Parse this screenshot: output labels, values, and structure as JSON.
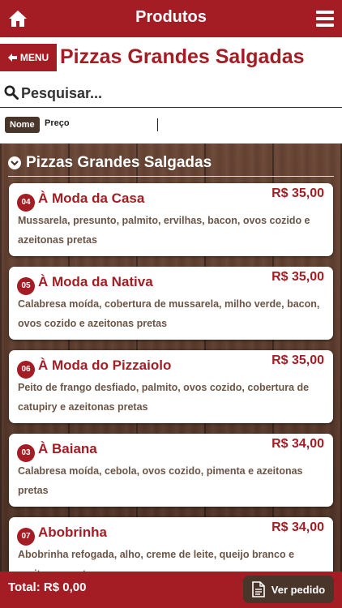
{
  "header": {
    "title": "Produtos",
    "icons": [
      "home-icon",
      "hamburger-menu-icon"
    ]
  },
  "menu_button": {
    "label": "MENU",
    "icon": "arrow-left-icon"
  },
  "page_title": "Pizzas Grandes Salgadas",
  "search": {
    "placeholder": "Pesquisar...",
    "value": "",
    "icon": "search-icon"
  },
  "sort": {
    "nome_label": "Nome",
    "preco_label": "Preço",
    "active": "Nome"
  },
  "section": {
    "title": "Pizzas Grandes Salgadas",
    "icon": "chevron-down-circle-icon"
  },
  "items": [
    {
      "code": "04",
      "name": "À Moda da Casa",
      "price": "R$ 35,00",
      "description": "Mussarela, presunto, palmito, ervilhas, bacon, ovos cozido e azeitonas pretas"
    },
    {
      "code": "05",
      "name": "À Moda da Nativa",
      "price": "R$ 35,00",
      "description": "Calabresa moída, cobertura de mussarela, milho verde, bacon, ovos cozido e azeitonas pretas"
    },
    {
      "code": "06",
      "name": "À Moda do Pizzaiolo",
      "price": "R$ 35,00",
      "description": "Peito de frango desfiado, palmito, ovos cozido, cobertura de catupiry e azeitonas pretas"
    },
    {
      "code": "03",
      "name": "À Baiana",
      "price": "R$ 34,00",
      "description": "Calabresa moída, cebola, ovos cozido, pimenta e azeitonas pretas"
    },
    {
      "code": "07",
      "name": "Abobrinha",
      "price": "R$ 34,00",
      "description": "Abobrinha refogada, alho, creme de leite, queijo branco e azeitonas pretas"
    }
  ],
  "footer": {
    "total": "Total: R$ 0,00",
    "order_button": "Ver pedido",
    "order_icon": "document-icon"
  },
  "colors": {
    "brand_red": "#a41d24",
    "dark_brown": "#4a352a",
    "desc_brown": "#6b5546"
  }
}
